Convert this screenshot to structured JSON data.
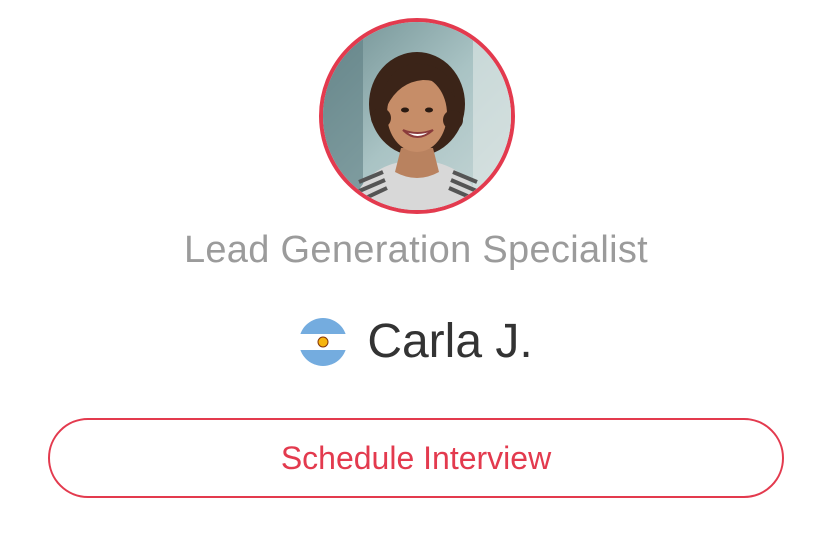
{
  "profile": {
    "role": "Lead Generation Specialist",
    "name": "Carla J.",
    "country_flag_icon": "argentina-flag-icon",
    "photo_icon": "profile-photo"
  },
  "actions": {
    "schedule_label": "Schedule Interview"
  },
  "colors": {
    "accent": "#e33a4e",
    "role_text": "#9b9b9b",
    "name_text": "#333333",
    "background": "#ffffff"
  }
}
